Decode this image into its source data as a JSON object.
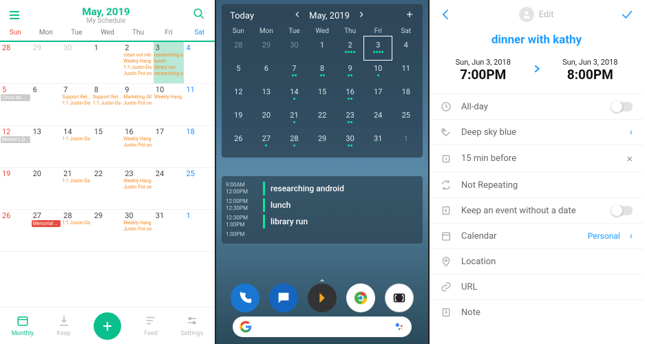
{
  "screen1": {
    "title": "May, 2019",
    "subtitle": "My Schedule",
    "dow": [
      "Sun",
      "Mon",
      "Tue",
      "Wed",
      "Thu",
      "Fri",
      "Sat"
    ],
    "weeks": [
      [
        {
          "n": 28,
          "sun": true,
          "dim": true
        },
        {
          "n": 29,
          "dim": true
        },
        {
          "n": 30,
          "dim": true
        },
        {
          "n": 1
        },
        {
          "n": 2,
          "ev": [
            "clean out inb",
            "Weekly Hang",
            "1:1 Justin-Da",
            "Justin Pot on"
          ]
        },
        {
          "n": 3,
          "today": true,
          "ev": [
            "researching a",
            "lunch",
            "library run",
            "researching a"
          ]
        },
        {
          "n": 4,
          "sat": true
        }
      ],
      [
        {
          "n": 5,
          "sun": true,
          "pill": "Cinco de Ma"
        },
        {
          "n": 6
        },
        {
          "n": 7,
          "ev": [
            "Support Retro",
            "1:1 Justin-Da"
          ]
        },
        {
          "n": 8,
          "ev": [
            "Support Retro",
            "1:1 Justin-Da"
          ]
        },
        {
          "n": 9,
          "ev": [
            "Marketing All",
            "Justin Pot on"
          ]
        },
        {
          "n": 10,
          "ev": [
            "Weekly Hang"
          ]
        },
        {
          "n": 11,
          "sat": true
        }
      ],
      [
        {
          "n": 12,
          "sun": true,
          "pill": "Mother's Day"
        },
        {
          "n": 13
        },
        {
          "n": 14,
          "ev": [
            "1:1 Justin-Da"
          ]
        },
        {
          "n": 15
        },
        {
          "n": 16,
          "ev": [
            "Weekly Hang",
            "Justin Pot on"
          ]
        },
        {
          "n": 17
        },
        {
          "n": 18,
          "sat": true
        }
      ],
      [
        {
          "n": 19,
          "sun": true
        },
        {
          "n": 20
        },
        {
          "n": 21,
          "ev": [
            "1:1 Justin-Da"
          ]
        },
        {
          "n": 22
        },
        {
          "n": 23,
          "ev": [
            "Weekly Hang",
            "Justin Pot on"
          ]
        },
        {
          "n": 24
        },
        {
          "n": 25,
          "sat": true
        }
      ],
      [
        {
          "n": 26,
          "sun": true
        },
        {
          "n": 27,
          "pillRed": "Memorial Da"
        },
        {
          "n": 28,
          "ev": [
            "1:1 Justin-Da"
          ]
        },
        {
          "n": 29
        },
        {
          "n": 30,
          "ev": [
            "Weekly Hang",
            "Justin Pot on"
          ]
        },
        {
          "n": 31
        },
        {
          "n": "1",
          "sat": true,
          "dim": true
        }
      ]
    ],
    "tabs": {
      "monthly": "Monthly",
      "keep": "Keep",
      "feed": "Feed",
      "settings": "Settings"
    }
  },
  "screen2": {
    "today": "Today",
    "month": "May, 2019",
    "dow": [
      "Sun",
      "Mon",
      "Tue",
      "Wed",
      "Thu",
      "Fri",
      "Sat"
    ],
    "weeks": [
      [
        {
          "n": 28,
          "dim": true
        },
        {
          "n": 29,
          "dim": true
        },
        {
          "n": 30,
          "dim": true
        },
        {
          "n": 1
        },
        {
          "n": 2,
          "d": 4
        },
        {
          "n": 3,
          "d": 4,
          "sel": true
        },
        {
          "n": 4
        }
      ],
      [
        {
          "n": 5
        },
        {
          "n": 6
        },
        {
          "n": 7,
          "d": 2
        },
        {
          "n": 8,
          "d": 2
        },
        {
          "n": 9,
          "d": 2
        },
        {
          "n": 10,
          "d": 1
        },
        {
          "n": 11
        }
      ],
      [
        {
          "n": 12
        },
        {
          "n": 13
        },
        {
          "n": 14,
          "d": 1
        },
        {
          "n": 15
        },
        {
          "n": 16,
          "d": 2
        },
        {
          "n": 17
        },
        {
          "n": 18
        }
      ],
      [
        {
          "n": 19
        },
        {
          "n": 20
        },
        {
          "n": 21,
          "d": 1
        },
        {
          "n": 22
        },
        {
          "n": 23,
          "d": 2
        },
        {
          "n": 24
        },
        {
          "n": 25
        }
      ],
      [
        {
          "n": 26
        },
        {
          "n": 27,
          "d": 1
        },
        {
          "n": 28,
          "d": 1
        },
        {
          "n": 29
        },
        {
          "n": 30,
          "d": 2
        },
        {
          "n": 31
        },
        {
          "n": 1,
          "dim": true
        }
      ]
    ],
    "slots": [
      {
        "t1": "9:00AM",
        "t2": "12:00PM",
        "txt": "researching android"
      },
      {
        "t1": "12:00PM",
        "t2": "12:30PM",
        "txt": "lunch"
      },
      {
        "t1": "12:30PM",
        "t2": "1:00PM",
        "txt": "library run"
      },
      {
        "t1": "1:00PM",
        "t2": "",
        "txt": ""
      }
    ]
  },
  "screen3": {
    "edit": "Edit",
    "title": "dinner with kathy",
    "start": {
      "date": "Sun, Jun 3, 2018",
      "time": "7:00PM"
    },
    "end": {
      "date": "Sun, Jun 3, 2018",
      "time": "8:00PM"
    },
    "rows": {
      "allday": "All-day",
      "color": "Deep sky blue",
      "reminder": "15 min before",
      "repeat": "Not Repeating",
      "keep": "Keep an event without a date",
      "calendar": "Calendar",
      "calendar_val": "Personal",
      "location": "Location",
      "url": "URL",
      "note": "Note"
    }
  }
}
